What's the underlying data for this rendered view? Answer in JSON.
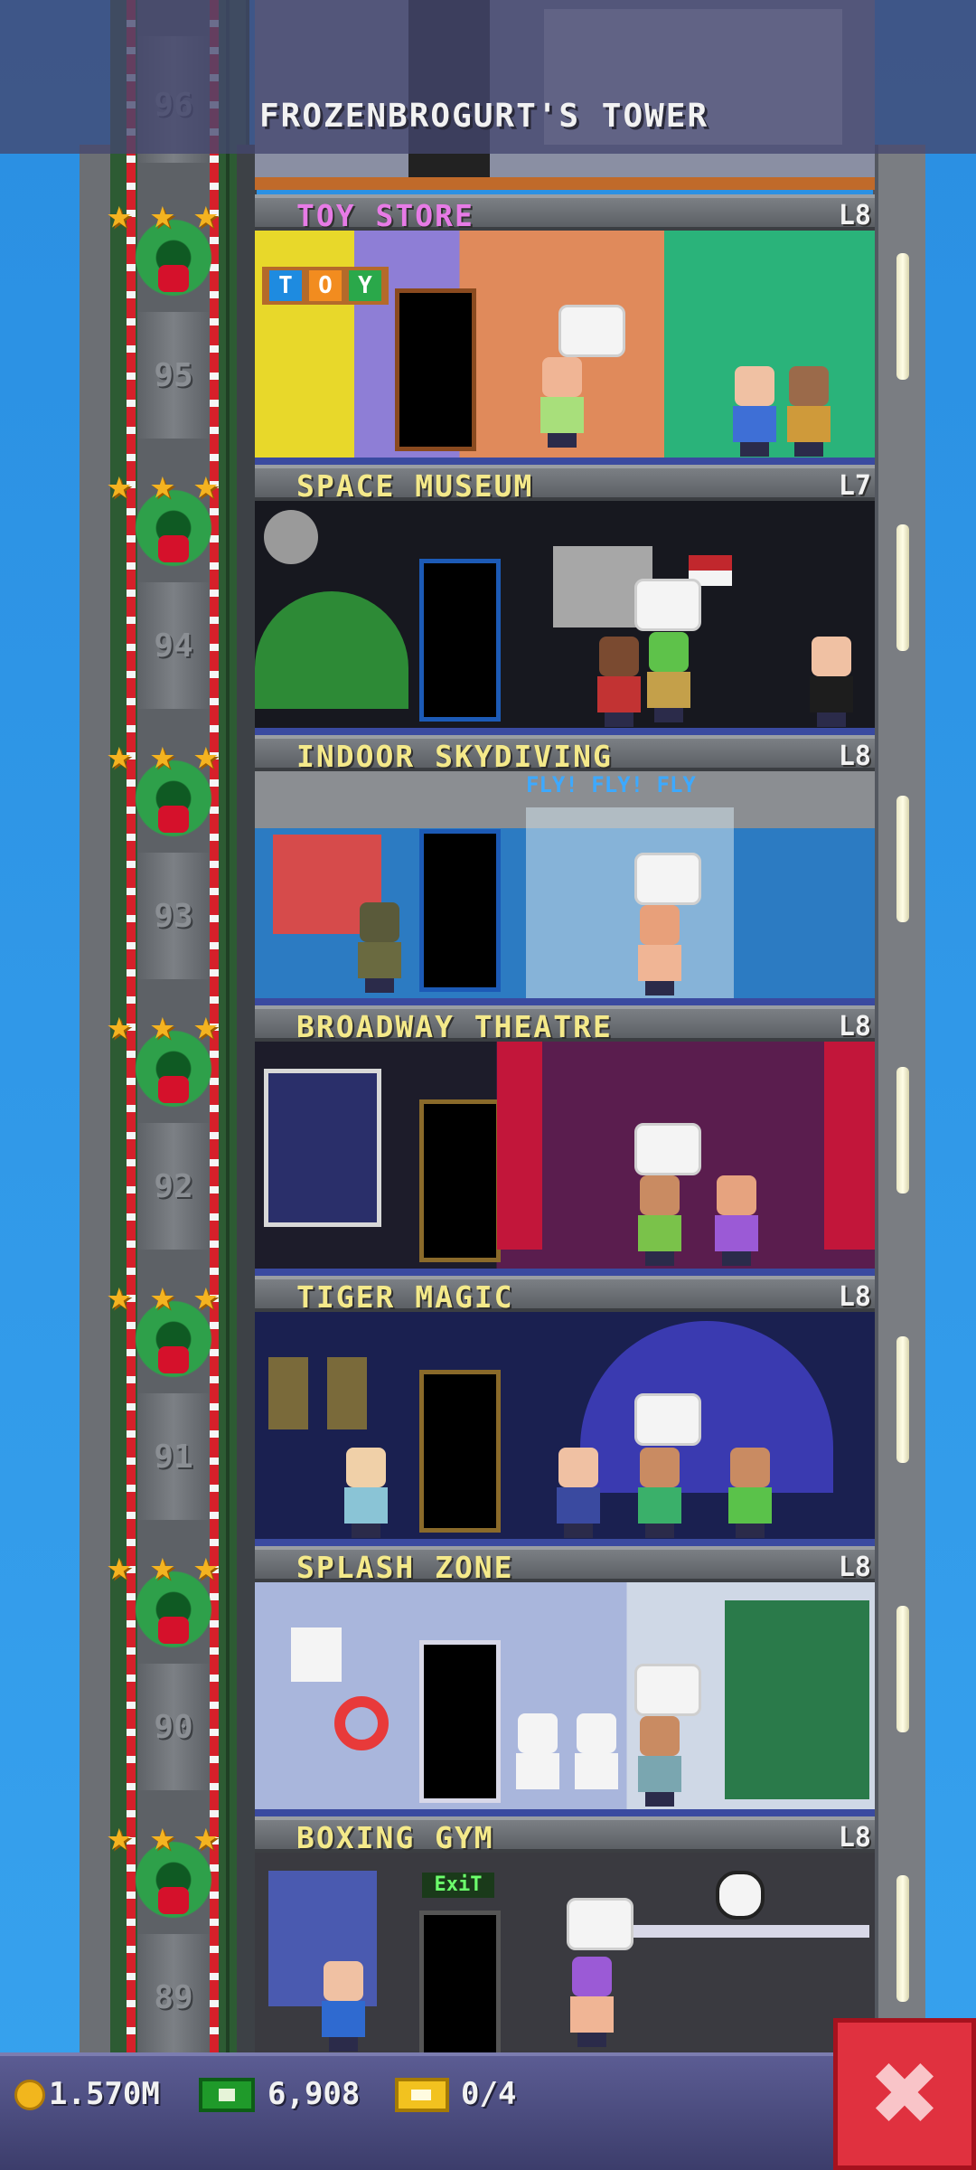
{
  "header": {
    "title": "FROZENBROGURT'S TOWER"
  },
  "top_floor_number": "96",
  "floors": [
    {
      "name": "TOY STORE",
      "level": "L8",
      "number": "95"
    },
    {
      "name": "SPACE MUSEUM",
      "level": "L7",
      "number": "94"
    },
    {
      "name": "INDOOR SKYDIVING",
      "level": "L8",
      "number": "93"
    },
    {
      "name": "BROADWAY THEATRE",
      "level": "L8",
      "number": "92"
    },
    {
      "name": "TIGER MAGIC",
      "level": "L8",
      "number": "91"
    },
    {
      "name": "SPLASH ZONE",
      "level": "L8",
      "number": "90"
    },
    {
      "name": "BOXING GYM",
      "level": "L8",
      "number": "89"
    }
  ],
  "scene_text": {
    "toy_blocks": [
      "T",
      "O",
      "Y"
    ],
    "skydiving_sign": "FLY! FLY! FLY",
    "gym_exit_sign": "ExiT"
  },
  "status_bar": {
    "coins": "1.570M",
    "tower_bux": "6,908",
    "tickets": "0/4"
  },
  "icons": {
    "coin": "coin-icon",
    "bux": "tower-bux-icon",
    "ticket": "vip-ticket-icon",
    "close": "close-icon",
    "star": "star-icon",
    "wreath": "christmas-wreath-icon"
  },
  "colors": {
    "sky": "#2f97e8",
    "floor_label": "#f4e98a",
    "toy_store_label": "#e77be6",
    "close_button": "#e0313f",
    "status_bar": "#4a4b7e"
  }
}
